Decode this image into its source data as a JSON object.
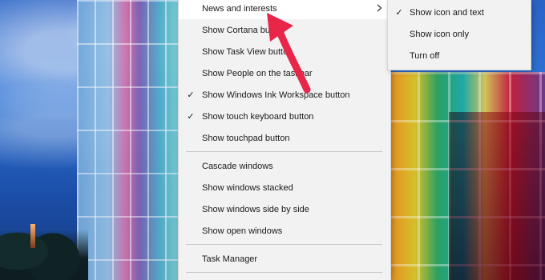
{
  "context_menu": {
    "items": [
      {
        "label": "News and interests",
        "checked": false,
        "submenu": true,
        "hover": true
      },
      {
        "label": "Show Cortana button",
        "checked": false
      },
      {
        "label": "Show Task View button",
        "checked": false
      },
      {
        "label": "Show People on the taskbar",
        "checked": false
      },
      {
        "label": "Show Windows Ink Workspace button",
        "checked": true
      },
      {
        "label": "Show touch keyboard button",
        "checked": true
      },
      {
        "label": "Show touchpad button",
        "checked": false
      },
      {
        "label": "Cascade windows",
        "checked": false
      },
      {
        "label": "Show windows stacked",
        "checked": false
      },
      {
        "label": "Show windows side by side",
        "checked": false
      },
      {
        "label": "Show open windows",
        "checked": false
      },
      {
        "label": "Task Manager",
        "checked": false
      }
    ],
    "check_glyph": "✓",
    "submenu_arrow_glyph": "›"
  },
  "submenu": {
    "items": [
      {
        "label": "Show icon and text",
        "checked": true
      },
      {
        "label": "Show icon only",
        "checked": false
      },
      {
        "label": "Turn off",
        "checked": false
      }
    ]
  },
  "annotation": {
    "arrow_color": "#e8264a"
  },
  "icons": {
    "check": "checkmark-icon",
    "submenu": "chevron-right-icon"
  }
}
